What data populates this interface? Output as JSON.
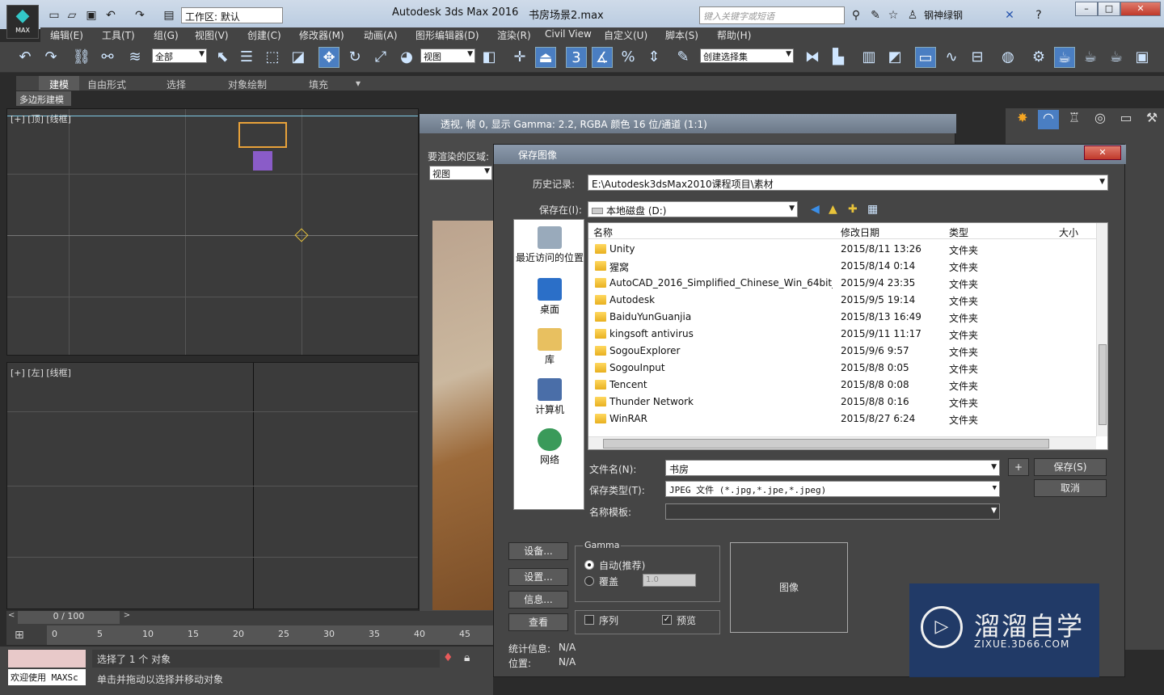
{
  "app": {
    "title": "Autodesk 3ds Max 2016",
    "document": "书房场景2.max",
    "workspace": "工作区: 默认",
    "search_placeholder": "键入关键字或短语",
    "user": "钢神绿钢",
    "logo_text": "MAX"
  },
  "menu": [
    "编辑(E)",
    "工具(T)",
    "组(G)",
    "视图(V)",
    "创建(C)",
    "修改器(M)",
    "动画(A)",
    "图形编辑器(D)",
    "渲染(R)",
    "Civil View",
    "自定义(U)",
    "脚本(S)",
    "帮助(H)"
  ],
  "toolbar": {
    "filter_value": "全部",
    "ref_coord": "视图",
    "selection_set": "创建选择集"
  },
  "ribbon": {
    "tabs": [
      "建模",
      "自由形式",
      "选择",
      "对象绘制",
      "填充"
    ],
    "sub": "多边形建模"
  },
  "viewports": {
    "top_label": "[+] [顶] [线框]",
    "left_label": "[+] [左] [线框]"
  },
  "vfb": {
    "title": "透视, 帧 0, 显示 Gamma: 2.2, RGBA 颜色 16 位/通道 (1:1)",
    "area_label": "要渲染的区域:",
    "area_value": "视图"
  },
  "dialog": {
    "title": "保存图像",
    "history_label": "历史记录:",
    "history_value": "E:\\Autodesk3dsMax2010课程项目\\素材",
    "savein_label": "保存在(I):",
    "savein_value": "本地磁盘 (D:)",
    "places": [
      "最近访问的位置",
      "桌面",
      "库",
      "计算机",
      "网络"
    ],
    "columns": [
      "名称",
      "修改日期",
      "类型",
      "大小"
    ],
    "files": [
      {
        "name": "Unity",
        "date": "2015/8/11 13:26",
        "type": "文件夹"
      },
      {
        "name": "猩窝",
        "date": "2015/8/14 0:14",
        "type": "文件夹"
      },
      {
        "name": "AutoCAD_2016_Simplified_Chinese_Win_64bit_...",
        "date": "2015/9/4 23:35",
        "type": "文件夹"
      },
      {
        "name": "Autodesk",
        "date": "2015/9/5 19:14",
        "type": "文件夹"
      },
      {
        "name": "BaiduYunGuanjia",
        "date": "2015/8/13 16:49",
        "type": "文件夹"
      },
      {
        "name": "kingsoft antivirus",
        "date": "2015/9/11 11:17",
        "type": "文件夹"
      },
      {
        "name": "SogouExplorer",
        "date": "2015/9/6 9:57",
        "type": "文件夹"
      },
      {
        "name": "SogouInput",
        "date": "2015/8/8 0:05",
        "type": "文件夹"
      },
      {
        "name": "Tencent",
        "date": "2015/8/8 0:08",
        "type": "文件夹"
      },
      {
        "name": "Thunder Network",
        "date": "2015/8/8 0:16",
        "type": "文件夹"
      },
      {
        "name": "WinRAR",
        "date": "2015/8/27 6:24",
        "type": "文件夹"
      }
    ],
    "filename_label": "文件名(N):",
    "filename_value": "书房",
    "filetype_label": "保存类型(T):",
    "filetype_value": "JPEG 文件 (*.jpg,*.jpe,*.jpeg)",
    "template_label": "名称模板:",
    "plus_label": "+",
    "save_label": "保存(S)",
    "cancel_label": "取消",
    "devices_label": "设备...",
    "setup_label": "设置...",
    "info_label": "信息...",
    "view_label": "查看",
    "gamma_group": "Gamma",
    "gamma_auto": "自动(推荐)",
    "gamma_override": "覆盖",
    "gamma_value": "1.0",
    "sequence_label": "序列",
    "preview_label": "预览",
    "image_label": "图像",
    "stats_label": "统计信息:",
    "stats_value": "N/A",
    "location_label": "位置:",
    "location_value": "N/A"
  },
  "timeline": {
    "frame": "0 / 100",
    "ticks": [
      "0",
      "5",
      "10",
      "15",
      "20",
      "25",
      "30",
      "35",
      "40",
      "45"
    ]
  },
  "status": {
    "selection": "选择了 1 个 对象",
    "prompt": "单击并拖动以选择并移动对象",
    "welcome": "欢迎使用 MAXSc"
  },
  "watermark": {
    "text": "溜溜自学",
    "sub": "ZIXUE.3D66.COM"
  },
  "colors": {
    "accent": "#4a7ec2",
    "title_bar": "#b9cbe0",
    "panel": "#444444",
    "viewport": "#3b3b3b"
  }
}
